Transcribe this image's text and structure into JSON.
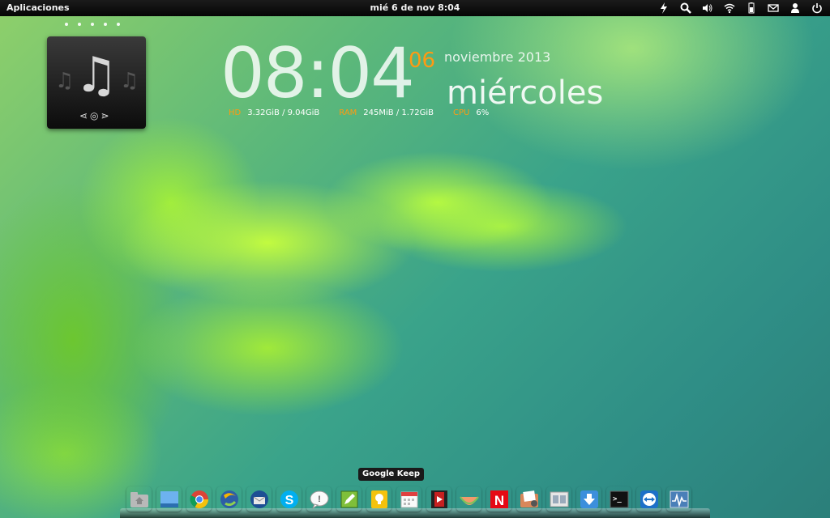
{
  "panel": {
    "apps_label": "Aplicaciones",
    "clock": "mié  6 de nov  8:04"
  },
  "indicators": [
    "power-bolt-icon",
    "search-icon",
    "volume-icon",
    "wifi-icon",
    "battery-icon",
    "mail-icon",
    "user-icon",
    "power-icon"
  ],
  "music_widget": {
    "main_glyph": "♫",
    "side_glyph": "♫",
    "controls": "⋖◎⋗"
  },
  "conky": {
    "time": "08:04",
    "day": "06",
    "month_year": "noviembre 2013",
    "weekday": "miércoles",
    "hd_label": "HD",
    "hd_value": "3.32GiB / 9.04GiB",
    "ram_label": "RAM",
    "ram_value": "245MiB / 1.72GiB",
    "cpu_label": "CPU",
    "cpu_value": "6%"
  },
  "tooltip": "Google Keep",
  "dock": [
    {
      "name": "home-folder-icon",
      "color": "#cfcfcf"
    },
    {
      "name": "desktop-icon",
      "color": "#4a8fd6"
    },
    {
      "name": "chrome-icon",
      "color": "#e8e8e8"
    },
    {
      "name": "eclipse-icon",
      "color": "#2d77c6"
    },
    {
      "name": "thunderbird-icon",
      "color": "#3d6fb6"
    },
    {
      "name": "skype-icon",
      "color": "#00aff0"
    },
    {
      "name": "chat-bubble-icon",
      "color": "#f0f0f0"
    },
    {
      "name": "google-keep-icon",
      "color": "#6aa031"
    },
    {
      "name": "lightbulb-note-icon",
      "color": "#f4c20d"
    },
    {
      "name": "calendar-icon",
      "color": "#f2f2f2"
    },
    {
      "name": "video-player-icon",
      "color": "#b82020"
    },
    {
      "name": "melon-icon",
      "color": "#f08a5d"
    },
    {
      "name": "netflix-icon",
      "color": "#e50914"
    },
    {
      "name": "photo-folder-icon",
      "color": "#d66a3a"
    },
    {
      "name": "window-switcher-icon",
      "color": "#dcdcdc"
    },
    {
      "name": "download-icon",
      "color": "#3c8fdc"
    },
    {
      "name": "terminal-icon",
      "color": "#1e1e1e"
    },
    {
      "name": "teamviewer-icon",
      "color": "#1e70c8"
    },
    {
      "name": "system-monitor-icon",
      "color": "#5a8fc6"
    }
  ],
  "accent_color": "#ff9a12"
}
